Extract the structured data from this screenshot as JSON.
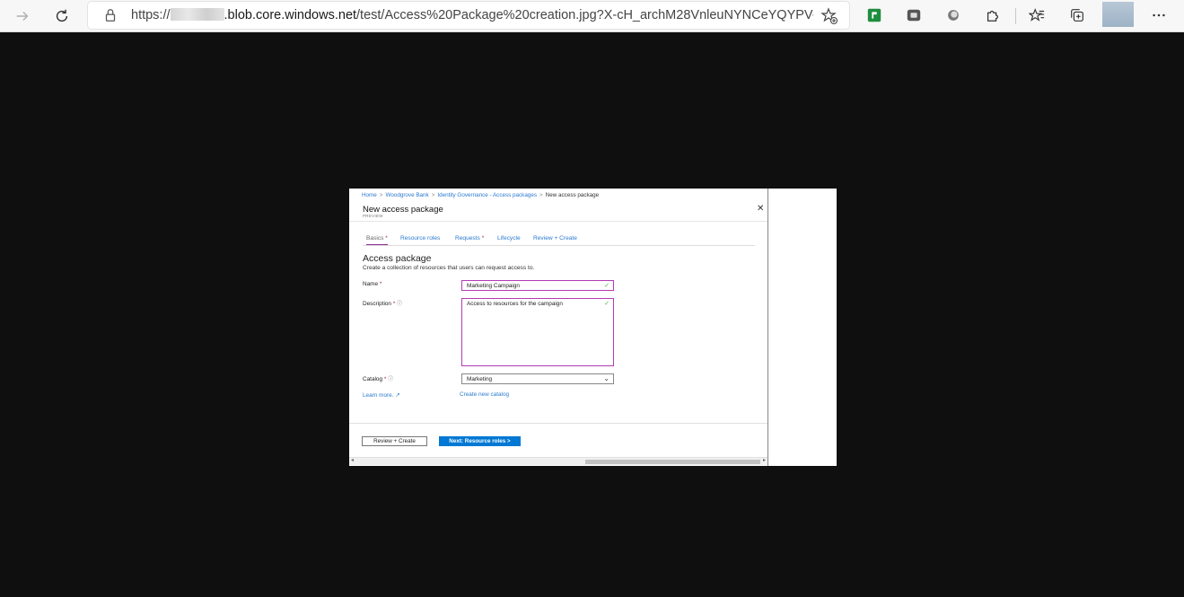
{
  "browser": {
    "url_prefix": "https://",
    "url_host": ".blob.core.windows.net",
    "url_rest": "/test/Access%20Package%20creation.jpg?X-cH_archM28VnleuNYNCeYQYPV-keX...",
    "icons": [
      "back-arrow-icon",
      "refresh-icon",
      "lock-icon",
      "add-favorite-icon",
      "extension-green-icon",
      "extension-gray-icon",
      "extension-circle-icon",
      "extensions-puzzle-icon",
      "favorites-icon",
      "collections-icon",
      "more-icon"
    ]
  },
  "image": {
    "breadcrumb": [
      "Home",
      "Woodgrove Bank",
      "Identity Governance - Access packages",
      "New access package"
    ],
    "title": "New access package",
    "preview_label": "PREVIEW",
    "close_label": "✕",
    "tabs": [
      {
        "label": "Basics",
        "required": "*"
      },
      {
        "label": "Resource roles",
        "required": ""
      },
      {
        "label": "Requests",
        "required": "*"
      },
      {
        "label": "Lifecycle",
        "required": ""
      },
      {
        "label": "Review + Create",
        "required": ""
      }
    ],
    "section_title": "Access package",
    "section_subtitle": "Create a collection of resources that users can request access to.",
    "name_label": "Name",
    "name_value": "Marketing Campaign",
    "description_label": "Description",
    "description_value": "Access to resources for the campaign",
    "catalog_label": "Catalog",
    "catalog_value": "Marketing",
    "learn_more": "Learn more.",
    "create_catalog": "Create new catalog",
    "review_create_button": "Review + Create",
    "next_button": "Next: Resource roles >",
    "required_marker": "*"
  }
}
